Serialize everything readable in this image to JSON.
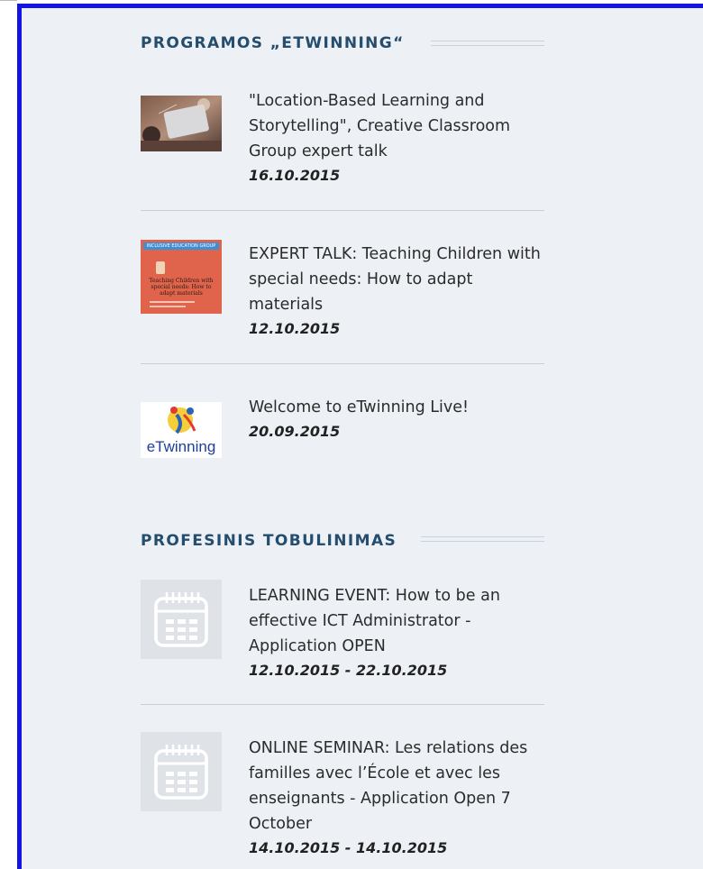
{
  "sections": [
    {
      "title": "PROGRAMOS „ETWINNING“",
      "items": [
        {
          "title": "\"Location-Based Learning and Storytelling\", Creative Classroom Group expert talk",
          "date": "16.10.2015",
          "thumb": "photo"
        },
        {
          "title": "EXPERT TALK: Teaching Children with special needs: How to adapt materials",
          "date": "12.10.2015",
          "thumb": "poster"
        },
        {
          "title": "Welcome to eTwinning Live!",
          "date": "20.09.2015",
          "thumb": "logo"
        }
      ]
    },
    {
      "title": "PROFESINIS TOBULINIMAS",
      "items": [
        {
          "title": "LEARNING EVENT: How to be an effective ICT Administrator - Application OPEN",
          "date": "12.10.2015 - 22.10.2015",
          "thumb": "calendar-icon"
        },
        {
          "title": "ONLINE SEMINAR: Les relations des familles avec l’École et avec les enseignants - Application Open 7 October",
          "date": "14.10.2015 - 14.10.2015",
          "thumb": "calendar-icon"
        }
      ]
    }
  ],
  "thumbs": {
    "poster_header": "INCLUSIVE EDUCATION GROUP",
    "poster_title": "Teaching Children with special needs: How to adapt materials",
    "logo_text": "eTwinning"
  },
  "colors": {
    "frame": "#1414e6",
    "background": "#edf1f6",
    "heading": "#254d6e",
    "poster": "#e0644c",
    "calendar_tile": "#dfe3e8"
  }
}
